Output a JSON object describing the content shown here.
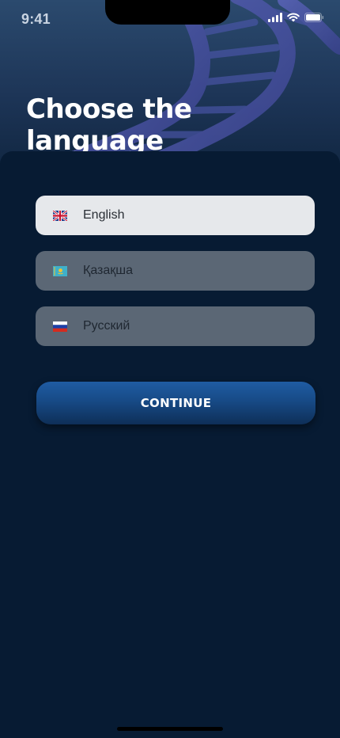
{
  "status_bar": {
    "time": "9:41"
  },
  "header": {
    "title": "Choose the language"
  },
  "languages": [
    {
      "label": "English",
      "flag": "uk-flag-icon",
      "selected": true
    },
    {
      "label": "Қазақша",
      "flag": "kz-flag-icon",
      "selected": false
    },
    {
      "label": "Русский",
      "flag": "ru-flag-icon",
      "selected": false
    }
  ],
  "actions": {
    "continue_label": "CONTINUE"
  },
  "colors": {
    "accent": "#1f5ca3",
    "background": "#071b33",
    "selected_option": "#e6e8eb",
    "unselected_option": "#5b6775"
  }
}
